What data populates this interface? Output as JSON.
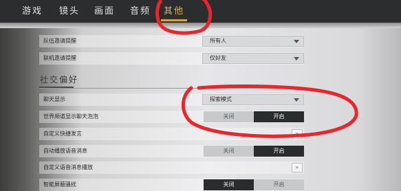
{
  "tabs": [
    {
      "label": "游戏"
    },
    {
      "label": "镜头"
    },
    {
      "label": "画面"
    },
    {
      "label": "音频"
    },
    {
      "label": "其他"
    }
  ],
  "rows": {
    "team_invite": {
      "label": "队伍邀请提醒",
      "value": "所有人"
    },
    "nearby_invite": {
      "label": "联机邀请提醒",
      "value": "仅好友"
    },
    "chat_display": {
      "label": "聊天显示",
      "value": "探索模式"
    },
    "world_chat_bubble": {
      "label": "世界频道显示聊天泡泡",
      "off_label": "关闭",
      "on_label": "开启"
    },
    "custom_quick_chat": {
      "label": "自定义快捷发言"
    },
    "auto_voice": {
      "label": "自动播放语音消息",
      "off_label": "关闭",
      "on_label": "开启"
    },
    "custom_voice_play": {
      "label": "自定义语音消息播放"
    },
    "smart_shield": {
      "label": "智能屏蔽骚扰",
      "off_label": "关闭",
      "on_label": "开启"
    }
  },
  "section": {
    "title": "社交偏好"
  },
  "edit_glyph": "»",
  "colors": {
    "active_tab": "#e0b04e",
    "annotation": "#e8262b",
    "toggle_on": "#2b2c2e"
  }
}
